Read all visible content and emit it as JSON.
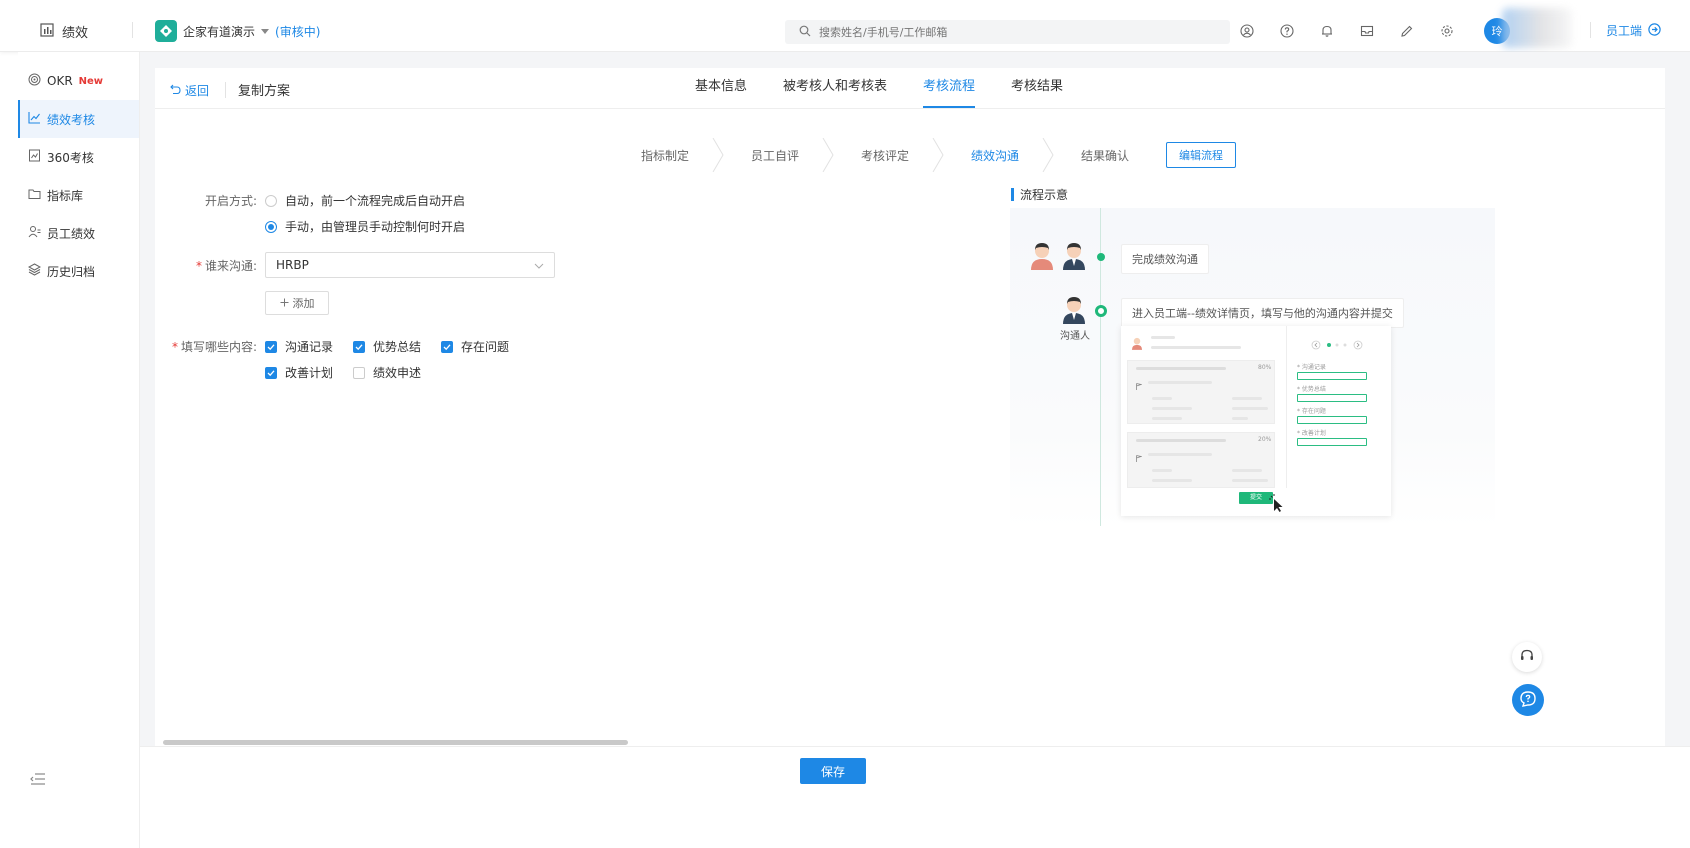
{
  "topbar": {
    "app_name": "绩效",
    "company": "企家有道演示",
    "company_status": "(审核中)",
    "search_placeholder": "搜索姓名/手机号/工作邮箱",
    "avatar_text": "玲",
    "employee_link": "员工端"
  },
  "sidebar": {
    "items": [
      {
        "label": "OKR",
        "badge": "New"
      },
      {
        "label": "绩效考核"
      },
      {
        "label": "360考核"
      },
      {
        "label": "指标库"
      },
      {
        "label": "员工绩效"
      },
      {
        "label": "历史归档"
      }
    ]
  },
  "header": {
    "back": "返回",
    "title": "复制方案",
    "tabs": [
      "基本信息",
      "被考核人和考核表",
      "考核流程",
      "考核结果"
    ]
  },
  "steps": [
    "指标制定",
    "员工自评",
    "考核评定",
    "绩效沟通",
    "结果确认"
  ],
  "edit_flow": "编辑流程",
  "form": {
    "open_label": "开启方式:",
    "open_auto": "自动，前一个流程完成后自动开启",
    "open_manual": "手动，由管理员手动控制何时开启",
    "who_label": "谁来沟通:",
    "who_value": "HRBP",
    "add": "添加",
    "content_label": "填写哪些内容:",
    "contents": [
      {
        "label": "沟通记录",
        "checked": true
      },
      {
        "label": "优势总结",
        "checked": true
      },
      {
        "label": "存在问题",
        "checked": true
      },
      {
        "label": "改善计划",
        "checked": true
      },
      {
        "label": "绩效申述",
        "checked": false
      }
    ]
  },
  "flow": {
    "title": "流程示意",
    "card1": "完成绩效沟通",
    "card2": "进入员工端--绩效详情页，填写与他的沟通内容并提交",
    "person_label": "沟通人",
    "mock_pct": "80%",
    "mock_pct2": "20%",
    "mock_fields": [
      "* 沟通记录",
      "* 优势总结",
      "* 存在问题",
      "* 改善计划"
    ],
    "mock_submit": "提交"
  },
  "footer": {
    "save": "保存"
  }
}
